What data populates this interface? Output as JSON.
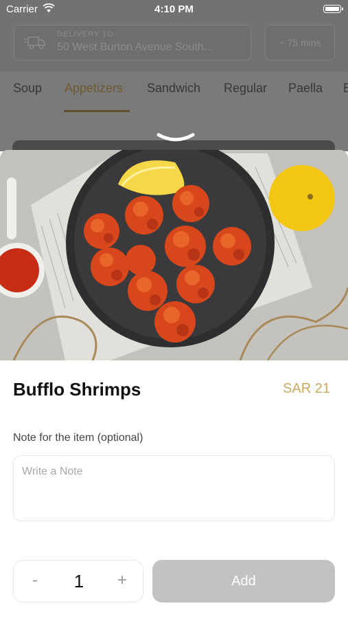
{
  "status_bar": {
    "carrier": "Carrier",
    "time": "4:10 PM"
  },
  "header": {
    "delivery_label": "DELIVERY TO",
    "delivery_address": "50 West Burton Avenue South...",
    "eta": "~ 75 mins"
  },
  "tabs": {
    "items": [
      "Soup",
      "Appetizers",
      "Sandwich",
      "Regular",
      "Paella",
      "B"
    ],
    "active_index": 1
  },
  "item": {
    "title": "Bufflo Shrimps",
    "price": "SAR 21",
    "note_label": "Note for the item (optional)",
    "note_placeholder": "Write a Note",
    "note_value": ""
  },
  "stepper": {
    "minus": "-",
    "quantity": "1",
    "plus": "+"
  },
  "add_button": {
    "label": "Add"
  },
  "colors": {
    "accent_gold": "#c9a860",
    "overlay_gray": "#727272",
    "add_disabled": "#c2c2c2"
  }
}
